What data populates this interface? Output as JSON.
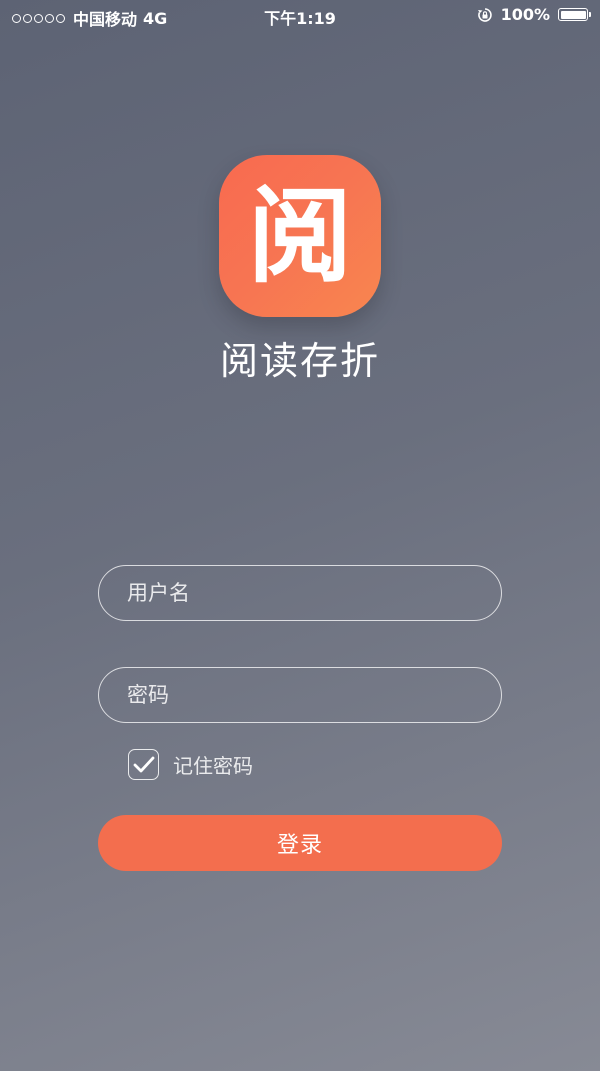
{
  "status_bar": {
    "carrier": "中国移动",
    "network": "4G",
    "time": "下午1:19",
    "battery": "100%",
    "battery_level": 1.0
  },
  "app": {
    "icon_glyph": "阅",
    "name": "阅读存折",
    "brand_color": "#f36e4e"
  },
  "form": {
    "username_placeholder": "用户名",
    "username_value": "",
    "password_placeholder": "密码",
    "password_value": "",
    "remember_label": "记住密码",
    "remember_checked": true,
    "login_label": "登录"
  }
}
